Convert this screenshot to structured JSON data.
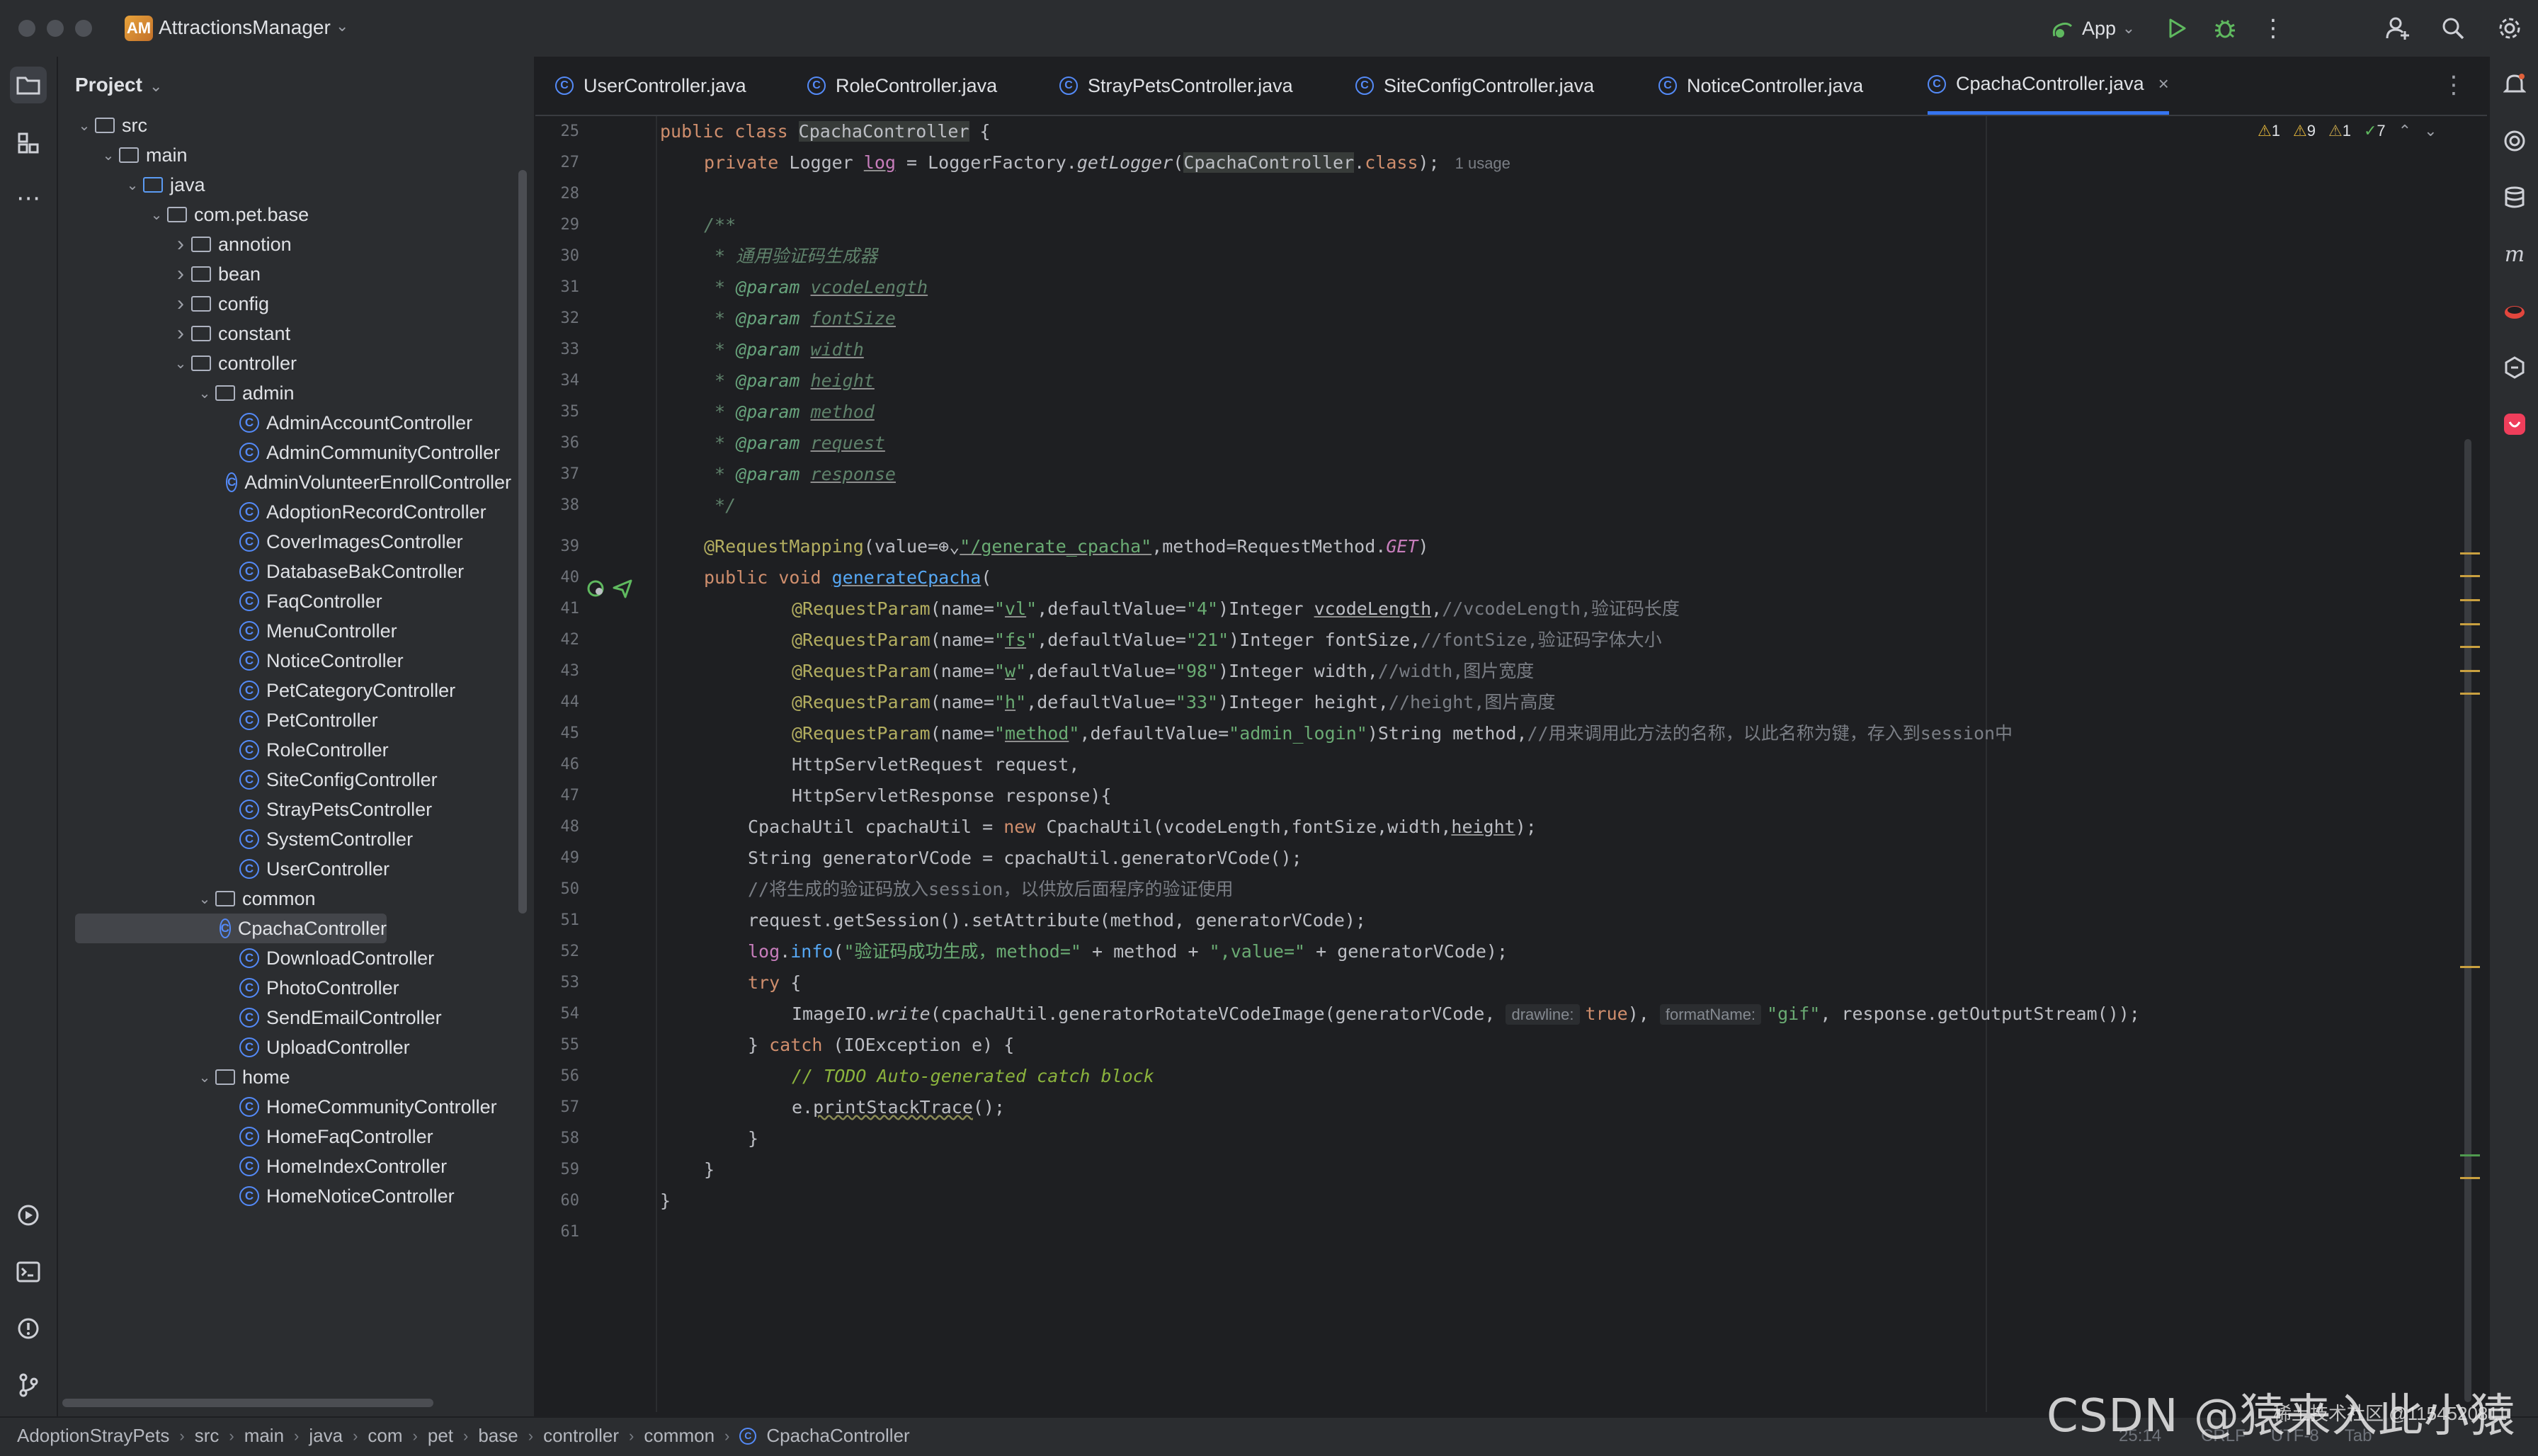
{
  "window": {
    "project_badge": "AM",
    "project_name": "AttractionsManager",
    "run_config": "App"
  },
  "colors": {
    "accent": "#3574f0",
    "background": "#1e1f22",
    "panel": "#2b2d30",
    "keyword": "#cf8e6d",
    "string": "#6aab73",
    "annotation": "#b3ae60",
    "field": "#c77dbb",
    "function": "#56a8f5"
  },
  "project_panel": {
    "title": "Project",
    "tree": [
      {
        "label": "src",
        "depth": 1,
        "type": "folder",
        "expanded": true
      },
      {
        "label": "main",
        "depth": 2,
        "type": "folder",
        "expanded": true
      },
      {
        "label": "java",
        "depth": 3,
        "type": "folder-blue",
        "expanded": true
      },
      {
        "label": "com.pet.base",
        "depth": 4,
        "type": "folder",
        "expanded": true
      },
      {
        "label": "annotion",
        "depth": 5,
        "type": "folder",
        "expanded": false
      },
      {
        "label": "bean",
        "depth": 5,
        "type": "folder",
        "expanded": false
      },
      {
        "label": "config",
        "depth": 5,
        "type": "folder",
        "expanded": false
      },
      {
        "label": "constant",
        "depth": 5,
        "type": "folder",
        "expanded": false
      },
      {
        "label": "controller",
        "depth": 5,
        "type": "folder",
        "expanded": true
      },
      {
        "label": "admin",
        "depth": 6,
        "type": "folder",
        "expanded": true
      },
      {
        "label": "AdminAccountController",
        "depth": 7,
        "type": "class"
      },
      {
        "label": "AdminCommunityController",
        "depth": 7,
        "type": "class"
      },
      {
        "label": "AdminVolunteerEnrollController",
        "depth": 7,
        "type": "class"
      },
      {
        "label": "AdoptionRecordController",
        "depth": 7,
        "type": "class"
      },
      {
        "label": "CoverImagesController",
        "depth": 7,
        "type": "class"
      },
      {
        "label": "DatabaseBakController",
        "depth": 7,
        "type": "class"
      },
      {
        "label": "FaqController",
        "depth": 7,
        "type": "class"
      },
      {
        "label": "MenuController",
        "depth": 7,
        "type": "class"
      },
      {
        "label": "NoticeController",
        "depth": 7,
        "type": "class"
      },
      {
        "label": "PetCategoryController",
        "depth": 7,
        "type": "class"
      },
      {
        "label": "PetController",
        "depth": 7,
        "type": "class"
      },
      {
        "label": "RoleController",
        "depth": 7,
        "type": "class"
      },
      {
        "label": "SiteConfigController",
        "depth": 7,
        "type": "class"
      },
      {
        "label": "StrayPetsController",
        "depth": 7,
        "type": "class"
      },
      {
        "label": "SystemController",
        "depth": 7,
        "type": "class"
      },
      {
        "label": "UserController",
        "depth": 7,
        "type": "class"
      },
      {
        "label": "common",
        "depth": 6,
        "type": "folder",
        "expanded": true
      },
      {
        "label": "CpachaController",
        "depth": 7,
        "type": "class",
        "selected": true
      },
      {
        "label": "DownloadController",
        "depth": 7,
        "type": "class"
      },
      {
        "label": "PhotoController",
        "depth": 7,
        "type": "class"
      },
      {
        "label": "SendEmailController",
        "depth": 7,
        "type": "class"
      },
      {
        "label": "UploadController",
        "depth": 7,
        "type": "class"
      },
      {
        "label": "home",
        "depth": 6,
        "type": "folder",
        "expanded": true
      },
      {
        "label": "HomeCommunityController",
        "depth": 7,
        "type": "class"
      },
      {
        "label": "HomeFaqController",
        "depth": 7,
        "type": "class"
      },
      {
        "label": "HomeIndexController",
        "depth": 7,
        "type": "class"
      },
      {
        "label": "HomeNoticeController",
        "depth": 7,
        "type": "class"
      }
    ]
  },
  "tabs": [
    {
      "label": "UserController.java"
    },
    {
      "label": "RoleController.java"
    },
    {
      "label": "StrayPetsController.java"
    },
    {
      "label": "SiteConfigController.java"
    },
    {
      "label": "NoticeController.java"
    },
    {
      "label": "CpachaController.java",
      "active": true
    }
  ],
  "inspections": {
    "warnings_a": "1",
    "warnings_b": "9",
    "weak_warnings": "1",
    "ok": "7"
  },
  "code": {
    "line_numbers": [
      "25",
      "27",
      "28",
      "29",
      "30",
      "31",
      "32",
      "33",
      "34",
      "35",
      "36",
      "37",
      "38",
      "39",
      "40",
      "41",
      "42",
      "43",
      "44",
      "45",
      "46",
      "47",
      "48",
      "49",
      "50",
      "51",
      "52",
      "53",
      "54",
      "55",
      "56",
      "57",
      "58",
      "59",
      "60",
      "61"
    ],
    "strings": {
      "usage_hint": "1 usage",
      "doc_title": " * 通用验证码生成器",
      "c_vl": "//vcodeLength,验证码长度",
      "c_fs": "//fontSize,验证码字体大小",
      "c_w": "//width,图片宽度",
      "c_h": "//height,图片高度",
      "c_method": "//用来调用此方法的名称，以此名称为键，存入到session中",
      "c_store": "//将生成的验证码放入session，以供放后面程序的验证使用",
      "log_msg": "\"验证码成功生成，method=\"",
      "log_val": "\",value=\"",
      "hint_drawline": "drawline:",
      "hint_format": "formatName:",
      "todo": "// TODO Auto-generated catch block",
      "mapping_path": "\"/generate_cpacha\""
    }
  },
  "breadcrumbs": [
    "AdoptionStrayPets",
    "src",
    "main",
    "java",
    "com",
    "pet",
    "base",
    "controller",
    "common",
    "CpachaController"
  ],
  "status": {
    "position": "25:14",
    "line_sep": "CRLF",
    "encoding": "UTF-8",
    "indent": "Tab"
  },
  "watermark": {
    "main": "CSDN @猿来入此小猿",
    "small": "稀土技术社区 @1154520811"
  }
}
